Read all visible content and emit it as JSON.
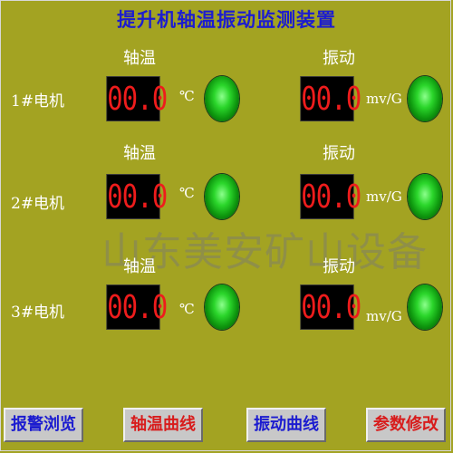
{
  "title": "提升机轴温振动监测装置",
  "section_labels": {
    "temp": "轴温",
    "vibration": "振动"
  },
  "motors": [
    {
      "name": "1#电机",
      "temp_value": "00.0",
      "temp_unit": "℃",
      "vib_value": "00.0",
      "vib_unit": "mv/G",
      "temp_status": "green",
      "vib_status": "green"
    },
    {
      "name": "2#电机",
      "temp_value": "00.0",
      "temp_unit": "℃",
      "vib_value": "00.0",
      "vib_unit": "mv/G",
      "temp_status": "green",
      "vib_status": "green"
    },
    {
      "name": "3#电机",
      "temp_value": "00.0",
      "temp_unit": "℃",
      "vib_value": "00.0",
      "vib_unit": "mv/G",
      "temp_status": "green",
      "vib_status": "green"
    }
  ],
  "watermark": "山东美安矿山设备",
  "buttons": {
    "alarm_browse": "报警浏览",
    "temp_curve": "轴温曲线",
    "vibration_curve": "振动曲线",
    "param_edit": "参数修改"
  },
  "colors": {
    "background": "#a3a322",
    "title": "#1c1cd0",
    "display_digits": "#ee1c1c",
    "indicator_ok": "#2bd62b"
  }
}
